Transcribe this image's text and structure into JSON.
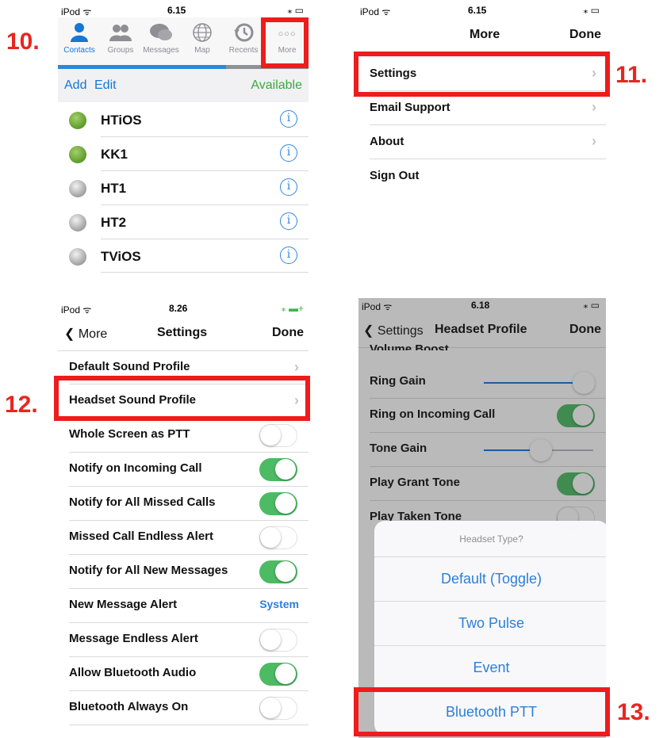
{
  "steps": {
    "s10": "10.",
    "s11": "11.",
    "s12": "12.",
    "s13": "13."
  },
  "panel1": {
    "status": {
      "carrier": "iPod ᯤ",
      "time": "6.15",
      "battery": "⁎ ▭"
    },
    "tabs": [
      {
        "label": "Contacts",
        "icon": "person-icon"
      },
      {
        "label": "Groups",
        "icon": "group-icon"
      },
      {
        "label": "Messages",
        "icon": "chat-icon"
      },
      {
        "label": "Map",
        "icon": "globe-icon"
      },
      {
        "label": "Recents",
        "icon": "clock-icon"
      },
      {
        "label": "More",
        "icon": "more-icon"
      }
    ],
    "more_glyph": "○○○",
    "add": "Add",
    "edit": "Edit",
    "availability": "Available",
    "contacts": [
      {
        "name": "HTiOS",
        "status": "green"
      },
      {
        "name": "KK1",
        "status": "green"
      },
      {
        "name": "HT1",
        "status": "grey"
      },
      {
        "name": "HT2",
        "status": "grey"
      },
      {
        "name": "TViOS",
        "status": "grey"
      }
    ],
    "info_glyph": "i",
    "colors": {
      "accent": "#1577d6",
      "available": "#3aa93a",
      "online": "#6aa83a",
      "offline": "#a0a0a0"
    }
  },
  "panel2": {
    "status": {
      "carrier": "iPod ᯤ",
      "time": "6.15",
      "battery": "⁎ ▭"
    },
    "title": "More",
    "done": "Done",
    "items": [
      "Settings",
      "Email Support",
      "About",
      "Sign Out"
    ],
    "chevron": "›"
  },
  "panel3": {
    "status": {
      "carrier": "iPod ᯤ",
      "time": "8.26",
      "battery": "⁎ ▬+"
    },
    "back": "❮ More",
    "title": "Settings",
    "done": "Done",
    "rows": [
      {
        "label": "Default Sound Profile",
        "type": "chevron"
      },
      {
        "label": "Headset Sound Profile",
        "type": "chevron"
      },
      {
        "label": "Whole Screen as PTT",
        "type": "switch",
        "on": false
      },
      {
        "label": "Notify on Incoming Call",
        "type": "switch",
        "on": true
      },
      {
        "label": "Notify for All Missed Calls",
        "type": "switch",
        "on": true
      },
      {
        "label": "Missed Call Endless Alert",
        "type": "switch",
        "on": false
      },
      {
        "label": "Notify for All New Messages",
        "type": "switch",
        "on": true
      },
      {
        "label": "New Message Alert",
        "type": "value",
        "value": "System"
      },
      {
        "label": "Message Endless Alert",
        "type": "switch",
        "on": false
      },
      {
        "label": "Allow Bluetooth Audio",
        "type": "switch",
        "on": true
      },
      {
        "label": "Bluetooth Always On",
        "type": "switch",
        "on": false
      }
    ],
    "colors": {
      "switch_on": "#4cbb64",
      "value": "#2d7fd8"
    }
  },
  "panel4": {
    "status": {
      "carrier": "iPod ᯤ",
      "time": "6.18",
      "battery": "⁎ ▭"
    },
    "back": "❮ Settings",
    "title": "Headset Profile",
    "done": "Done",
    "partial_top": "Volume Boost",
    "rows": [
      {
        "label": "Ring Gain",
        "type": "slider",
        "level": 0.92
      },
      {
        "label": "Ring on Incoming Call",
        "type": "switch",
        "on": true
      },
      {
        "label": "Tone Gain",
        "type": "slider",
        "level": 0.52
      },
      {
        "label": "Play Grant Tone",
        "type": "switch",
        "on": true
      },
      {
        "label": "Play Taken Tone",
        "type": "switch",
        "on": false
      }
    ],
    "sheet": {
      "title": "Headset Type?",
      "options": [
        "Default (Toggle)",
        "Two Pulse",
        "Event",
        "Bluetooth PTT"
      ]
    },
    "colors": {
      "slider": "#1f6fd6",
      "option": "#2c7fd6"
    }
  }
}
